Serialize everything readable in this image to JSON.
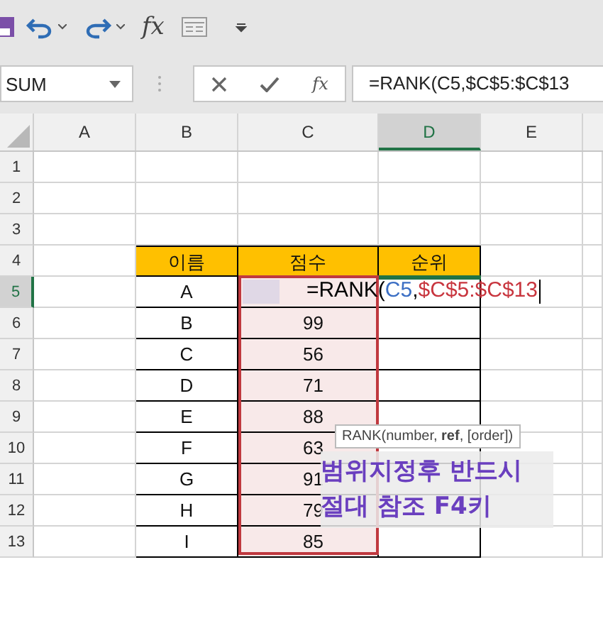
{
  "quick_access": {
    "function_label": "fx"
  },
  "formula_bar": {
    "name_box": "SUM",
    "fx_label": "fx",
    "formula": "=RANK(C5,$C$5:$C$13"
  },
  "columns": [
    {
      "label": "A",
      "selected": false
    },
    {
      "label": "B",
      "selected": false
    },
    {
      "label": "C",
      "selected": false
    },
    {
      "label": "D",
      "selected": true
    },
    {
      "label": "E",
      "selected": false
    }
  ],
  "rows": [
    {
      "label": "1",
      "selected": false
    },
    {
      "label": "2",
      "selected": false
    },
    {
      "label": "3",
      "selected": false
    },
    {
      "label": "4",
      "selected": false
    },
    {
      "label": "5",
      "selected": true
    },
    {
      "label": "6",
      "selected": false
    },
    {
      "label": "7",
      "selected": false
    },
    {
      "label": "8",
      "selected": false
    },
    {
      "label": "9",
      "selected": false
    },
    {
      "label": "10",
      "selected": false
    },
    {
      "label": "11",
      "selected": false
    },
    {
      "label": "12",
      "selected": false
    },
    {
      "label": "13",
      "selected": false
    }
  ],
  "table": {
    "headers": [
      "이름",
      "점수",
      "순위"
    ],
    "rows": [
      {
        "name": "A"
      },
      {
        "name": "B",
        "score": "99"
      },
      {
        "name": "C",
        "score": "56"
      },
      {
        "name": "D",
        "score": "71"
      },
      {
        "name": "E",
        "score": "88"
      },
      {
        "name": "F",
        "score": "63"
      },
      {
        "name": "G",
        "score": "91"
      },
      {
        "name": "H",
        "score": "79"
      },
      {
        "name": "I",
        "score": "85"
      }
    ]
  },
  "cell_edit": [
    {
      "text": "=RANK(",
      "color": "#000000"
    },
    {
      "text": "C5",
      "color": "#3c6fc4"
    },
    {
      "text": ",",
      "color": "#000000"
    },
    {
      "text": "$C$5:$C$13",
      "color": "#c8353e"
    }
  ],
  "tooltip": "RANK(number, **ref**, [order])",
  "annotation": [
    "범위지정후 반드시",
    "절대 참조 F4키"
  ]
}
